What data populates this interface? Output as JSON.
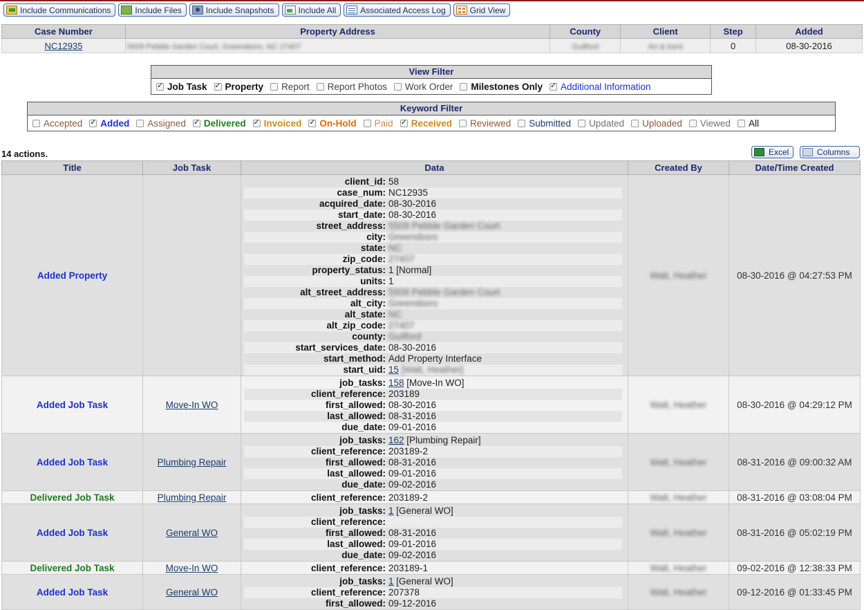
{
  "toolbar": [
    {
      "label": "Include Communications",
      "icon": "communications-icon"
    },
    {
      "label": "Include Files",
      "icon": "files-icon"
    },
    {
      "label": "Include Snapshots",
      "icon": "snapshots-icon"
    },
    {
      "label": "Include All",
      "icon": "include-all-icon"
    },
    {
      "label": "Associated Access Log",
      "icon": "access-log-icon"
    },
    {
      "label": "Grid View",
      "icon": "grid-view-icon"
    }
  ],
  "case": {
    "headers": [
      "Case Number",
      "Property Address",
      "County",
      "Client",
      "Step",
      "Added"
    ],
    "row": {
      "case_number": "NC12935",
      "property_address": "5509 Pebble Garden Court, Greensboro, NC 27407",
      "county": "Guilford",
      "client": "Art & Kent",
      "step": "0",
      "added": "08-30-2016"
    }
  },
  "view_filter": {
    "title": "View Filter",
    "items": [
      {
        "label": "Job Task",
        "checked": true,
        "color": "#111111",
        "bold": true
      },
      {
        "label": "Property",
        "checked": true,
        "color": "#111111",
        "bold": true
      },
      {
        "label": "Report",
        "checked": false,
        "color": "#444444",
        "bold": false
      },
      {
        "label": "Report Photos",
        "checked": false,
        "color": "#444444",
        "bold": false
      },
      {
        "label": "Work Order",
        "checked": false,
        "color": "#444444",
        "bold": false
      },
      {
        "label": "Milestones Only",
        "checked": false,
        "color": "#111111",
        "bold": true
      },
      {
        "label": "Additional Information",
        "checked": true,
        "color": "#1c2fd0",
        "bold": false
      }
    ]
  },
  "keyword_filter": {
    "title": "Keyword Filter",
    "items": [
      {
        "label": "Accepted",
        "checked": false,
        "color": "#8a5a3a",
        "bold": false
      },
      {
        "label": "Added",
        "checked": true,
        "color": "#1c2fd0",
        "bold": true
      },
      {
        "label": "Assigned",
        "checked": false,
        "color": "#8a5a3a",
        "bold": false
      },
      {
        "label": "Delivered",
        "checked": true,
        "color": "#1e7a1e",
        "bold": true
      },
      {
        "label": "Invoiced",
        "checked": true,
        "color": "#d08a10",
        "bold": true
      },
      {
        "label": "On-Hold",
        "checked": true,
        "color": "#e06a00",
        "bold": true
      },
      {
        "label": "Paid",
        "checked": false,
        "color": "#c09050",
        "bold": false
      },
      {
        "label": "Received",
        "checked": true,
        "color": "#d08a10",
        "bold": true
      },
      {
        "label": "Reviewed",
        "checked": false,
        "color": "#8a5a3a",
        "bold": false
      },
      {
        "label": "Submitted",
        "checked": false,
        "color": "#1a3a6a",
        "bold": false
      },
      {
        "label": "Updated",
        "checked": false,
        "color": "#707070",
        "bold": false
      },
      {
        "label": "Uploaded",
        "checked": false,
        "color": "#8a5a3a",
        "bold": false
      },
      {
        "label": "Viewed",
        "checked": false,
        "color": "#707070",
        "bold": false
      },
      {
        "label": "All",
        "checked": false,
        "color": "#111111",
        "bold": false
      }
    ]
  },
  "actions": {
    "count_text": "14 actions.",
    "excel_label": "Excel",
    "columns_label": "Columns",
    "headers": [
      "Title",
      "Job Task",
      "Data",
      "Created By",
      "Date/Time Created"
    ],
    "rows": [
      {
        "title": "Added Property",
        "kind": "added",
        "job_task": "",
        "created_by": "Walt, Heather",
        "datetime": "08-30-2016 @ 04:27:53 PM",
        "data": [
          {
            "k": "client_id:",
            "v": "58"
          },
          {
            "k": "case_num:",
            "v": "NC12935"
          },
          {
            "k": "acquired_date:",
            "v": "08-30-2016"
          },
          {
            "k": "start_date:",
            "v": "08-30-2016"
          },
          {
            "k": "street_address:",
            "v": "5509 Pebble Garden Court",
            "blur": true
          },
          {
            "k": "city:",
            "v": "Greensboro",
            "blur": true
          },
          {
            "k": "state:",
            "v": "NC",
            "blur": true
          },
          {
            "k": "zip_code:",
            "v": "27407",
            "blur": true
          },
          {
            "k": "property_status:",
            "v": "1 [Normal]"
          },
          {
            "k": "units:",
            "v": "1"
          },
          {
            "k": "alt_street_address:",
            "v": "5509 Pebble Garden Court",
            "blur": true
          },
          {
            "k": "alt_city:",
            "v": "Greensboro",
            "blur": true
          },
          {
            "k": "alt_state:",
            "v": "NC",
            "blur": true
          },
          {
            "k": "alt_zip_code:",
            "v": "27407",
            "blur": true
          },
          {
            "k": "county:",
            "v": "Guilford",
            "blur": true
          },
          {
            "k": "start_services_date:",
            "v": "08-30-2016"
          },
          {
            "k": "start_method:",
            "v": "Add Property Interface"
          },
          {
            "k": "start_uid:",
            "link": "15",
            "v": " [Walt, Heather]",
            "blur": true
          }
        ]
      },
      {
        "title": "Added Job Task",
        "kind": "added",
        "job_task": "Move-In WO",
        "created_by": "Walt, Heather",
        "datetime": "08-30-2016 @ 04:29:12 PM",
        "data": [
          {
            "k": "job_tasks:",
            "link": "158",
            "v": " [Move-In WO]"
          },
          {
            "k": "client_reference:",
            "v": "203189"
          },
          {
            "k": "first_allowed:",
            "v": "08-30-2016"
          },
          {
            "k": "last_allowed:",
            "v": "08-31-2016"
          },
          {
            "k": "due_date:",
            "v": "09-01-2016"
          }
        ]
      },
      {
        "title": "Added Job Task",
        "kind": "added",
        "job_task": "Plumbing Repair",
        "created_by": "Walt, Heather",
        "datetime": "08-31-2016 @ 09:00:32 AM",
        "data": [
          {
            "k": "job_tasks:",
            "link": "162",
            "v": " [Plumbing Repair]"
          },
          {
            "k": "client_reference:",
            "v": "203189-2"
          },
          {
            "k": "first_allowed:",
            "v": "08-31-2016"
          },
          {
            "k": "last_allowed:",
            "v": "09-01-2016"
          },
          {
            "k": "due_date:",
            "v": "09-02-2016"
          }
        ]
      },
      {
        "title": "Delivered Job Task",
        "kind": "delivered",
        "job_task": "Plumbing Repair",
        "created_by": "Walt, Heather",
        "datetime": "08-31-2016 @ 03:08:04 PM",
        "data": [
          {
            "k": "client_reference:",
            "v": "203189-2"
          }
        ]
      },
      {
        "title": "Added Job Task",
        "kind": "added",
        "job_task": "General WO",
        "created_by": "Walt, Heather",
        "datetime": "08-31-2016 @ 05:02:19 PM",
        "data": [
          {
            "k": "job_tasks:",
            "link": "1",
            "v": " [General WO]"
          },
          {
            "k": "client_reference:",
            "v": ""
          },
          {
            "k": "first_allowed:",
            "v": "08-31-2016"
          },
          {
            "k": "last_allowed:",
            "v": "09-01-2016"
          },
          {
            "k": "due_date:",
            "v": "09-02-2016"
          }
        ]
      },
      {
        "title": "Delivered Job Task",
        "kind": "delivered",
        "job_task": "Move-In WO",
        "created_by": "Walt, Heather",
        "datetime": "09-02-2016 @ 12:38:33 PM",
        "data": [
          {
            "k": "client_reference:",
            "v": "203189-1"
          }
        ]
      },
      {
        "title": "Added Job Task",
        "kind": "added",
        "job_task": "General WO",
        "created_by": "Walt, Heather",
        "datetime": "09-12-2016 @ 01:33:45 PM",
        "data": [
          {
            "k": "job_tasks:",
            "link": "1",
            "v": " [General WO]"
          },
          {
            "k": "client_reference:",
            "v": "207378"
          },
          {
            "k": "first_allowed:",
            "v": "09-12-2016"
          }
        ]
      }
    ]
  }
}
